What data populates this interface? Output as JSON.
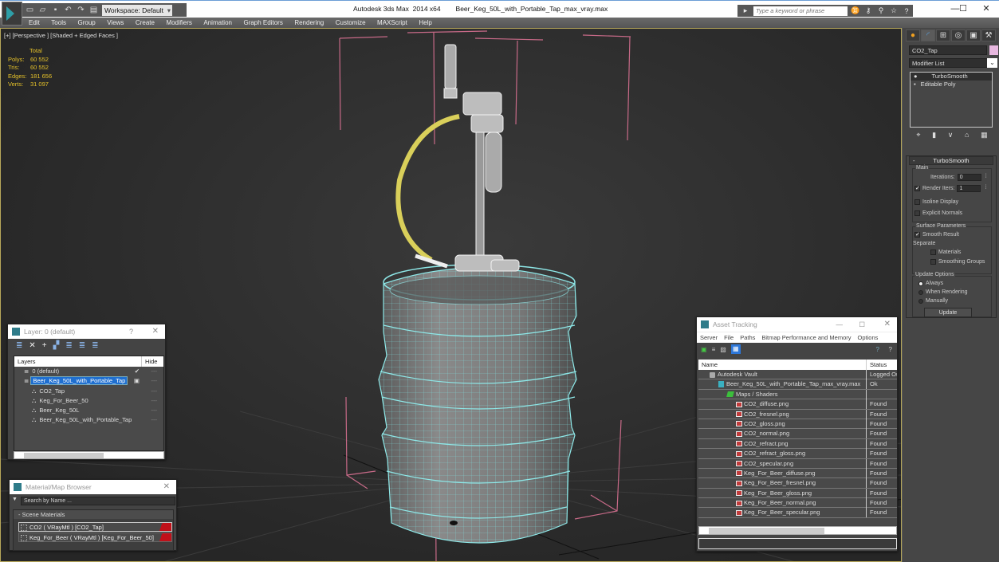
{
  "titlebar": {
    "app_title": "Autodesk 3ds Max  2014 x64",
    "file_name": "Beer_Keg_50L_with_Portable_Tap_max_vray.max",
    "workspace": "Workspace: Default",
    "search_placeholder": "Type a keyword or phrase",
    "quick_access_icons": [
      "new-file-icon",
      "open-file-icon",
      "save-icon",
      "undo-icon",
      "redo-icon",
      "project-folder-icon"
    ],
    "search_icons": [
      "binoculars-icon",
      "key-icon",
      "satellite-icon",
      "star-icon",
      "help-icon"
    ],
    "window_controls": {
      "minimize": "—",
      "maximize": "☐",
      "close": "✕"
    }
  },
  "menu": [
    "Edit",
    "Tools",
    "Group",
    "Views",
    "Create",
    "Modifiers",
    "Animation",
    "Graph Editors",
    "Rendering",
    "Customize",
    "MAXScript",
    "Help"
  ],
  "viewport": {
    "label": "[+] [Perspective ] [Shaded + Edged Faces ]",
    "stats": {
      "header": "Total",
      "rows": [
        {
          "key": "Polys:",
          "value": "60 552"
        },
        {
          "key": "Tris:",
          "value": "60 552"
        },
        {
          "key": "Edges:",
          "value": "181 656"
        },
        {
          "key": "Verts:",
          "value": "31 097"
        }
      ]
    }
  },
  "command_panel": {
    "tabs": [
      "create-tab",
      "modify-tab",
      "hierarchy-tab",
      "motion-tab",
      "display-tab",
      "utilities-tab"
    ],
    "object_name": "CO2_Tap",
    "object_color": "#e8b8e0",
    "modifier_list": "Modifier List",
    "stack": [
      "TurboSmooth",
      "Editable Poly"
    ],
    "turbosmooth": {
      "title": "TurboSmooth",
      "main_label": "Main",
      "iterations_label": "Iterations:",
      "iterations": "0",
      "render_iters_label": "Render Iters:",
      "render_iters": "1",
      "render_iters_checked": true,
      "isoline_display": "Isoline Display",
      "explicit_normals": "Explicit Normals",
      "surface_params_label": "Surface Parameters",
      "smooth_result": "Smooth Result",
      "separate_label": "Separate",
      "materials": "Materials",
      "smoothing_groups": "Smoothing Groups",
      "update_options_label": "Update Options",
      "always": "Always",
      "when_rendering": "When Rendering",
      "manually": "Manually",
      "update_button": "Update"
    }
  },
  "layer_dialog": {
    "title": "Layer: 0 (default)",
    "help": "?",
    "close": "✕",
    "col_layers": "Layers",
    "col_hide": "Hide",
    "rows": [
      {
        "name": "0 (default)",
        "indent": 1,
        "checked": true,
        "selected": false
      },
      {
        "name": "Beer_Keg_50L_with_Portable_Tap",
        "indent": 1,
        "checked": false,
        "selected": true
      },
      {
        "name": "CO2_Tap",
        "indent": 2,
        "checked": false,
        "selected": false
      },
      {
        "name": "Keg_For_Beer_50",
        "indent": 2,
        "checked": false,
        "selected": false
      },
      {
        "name": "Beer_Keg_50L",
        "indent": 2,
        "checked": false,
        "selected": false
      },
      {
        "name": "Beer_Keg_50L_with_Portable_Tap",
        "indent": 2,
        "checked": false,
        "selected": false
      }
    ]
  },
  "material_browser": {
    "title": "Material/Map Browser",
    "close": "✕",
    "search_placeholder": "Search by Name ...",
    "category": "- Scene Materials",
    "materials": [
      "CO2  ( VRayMtl ) [CO2_Tap]",
      "Keg_For_Beer  ( VRayMtl ) [Keg_For_Beer_50]"
    ]
  },
  "asset_tracking": {
    "title": "Asset Tracking",
    "menu": [
      "Server",
      "File",
      "Paths",
      "Bitmap Performance and Memory",
      "Options"
    ],
    "col_name": "Name",
    "col_status": "Status",
    "rows": [
      {
        "name": "Autodesk Vault",
        "status": "Logged Out",
        "type": "vault",
        "indent": 0
      },
      {
        "name": "Beer_Keg_50L_with_Portable_Tap_max_vray.max",
        "status": "Ok",
        "type": "max",
        "indent": 1
      },
      {
        "name": "Maps / Shaders",
        "status": "",
        "type": "map",
        "indent": 2
      },
      {
        "name": "CO2_diffuse.png",
        "status": "Found",
        "type": "png",
        "indent": 3
      },
      {
        "name": "CO2_fresnel.png",
        "status": "Found",
        "type": "png",
        "indent": 3
      },
      {
        "name": "CO2_gloss.png",
        "status": "Found",
        "type": "png",
        "indent": 3
      },
      {
        "name": "CO2_normal.png",
        "status": "Found",
        "type": "png",
        "indent": 3
      },
      {
        "name": "CO2_refract.png",
        "status": "Found",
        "type": "png",
        "indent": 3
      },
      {
        "name": "CO2_refract_gloss.png",
        "status": "Found",
        "type": "png",
        "indent": 3
      },
      {
        "name": "CO2_specular.png",
        "status": "Found",
        "type": "png",
        "indent": 3
      },
      {
        "name": "Keg_For_Beer_diffuse.png",
        "status": "Found",
        "type": "png",
        "indent": 3
      },
      {
        "name": "Keg_For_Beer_fresnel.png",
        "status": "Found",
        "type": "png",
        "indent": 3
      },
      {
        "name": "Keg_For_Beer_gloss.png",
        "status": "Found",
        "type": "png",
        "indent": 3
      },
      {
        "name": "Keg_For_Beer_normal.png",
        "status": "Found",
        "type": "png",
        "indent": 3
      },
      {
        "name": "Keg_For_Beer_specular.png",
        "status": "Found",
        "type": "png",
        "indent": 3
      }
    ]
  }
}
